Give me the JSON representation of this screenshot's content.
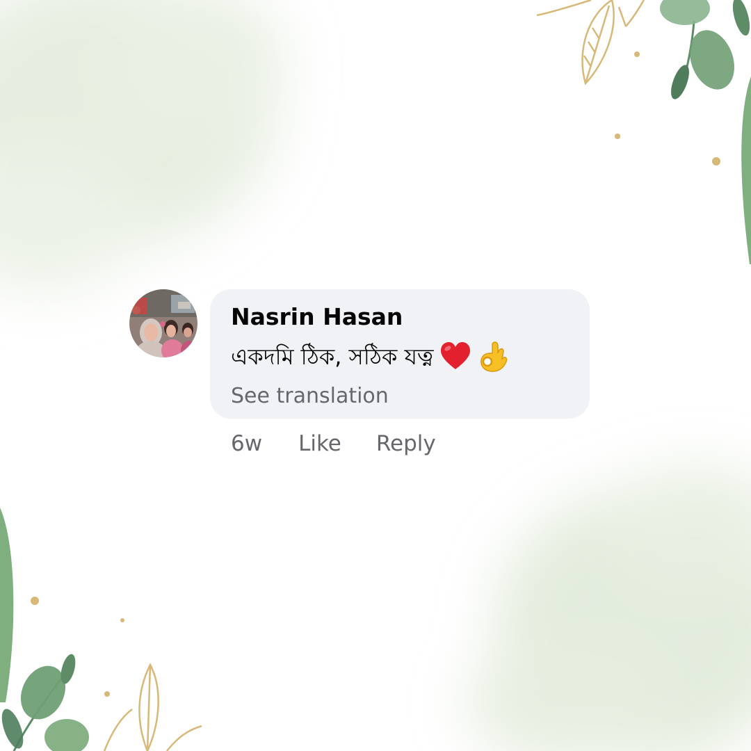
{
  "comment": {
    "author": "Nasrin Hasan",
    "text": "একদমি ঠিক, সঠিক যত্ন",
    "emojis": [
      "red-heart",
      "ok-hand"
    ],
    "see_translation": "See translation",
    "time": "6w",
    "like_label": "Like",
    "reply_label": "Reply"
  },
  "colors": {
    "bubble": "#f0f2f5",
    "author_text": "#050505",
    "secondary_text": "#65676b",
    "leaf_green": "#6f9f74",
    "gold_leaf": "#d8b878"
  }
}
